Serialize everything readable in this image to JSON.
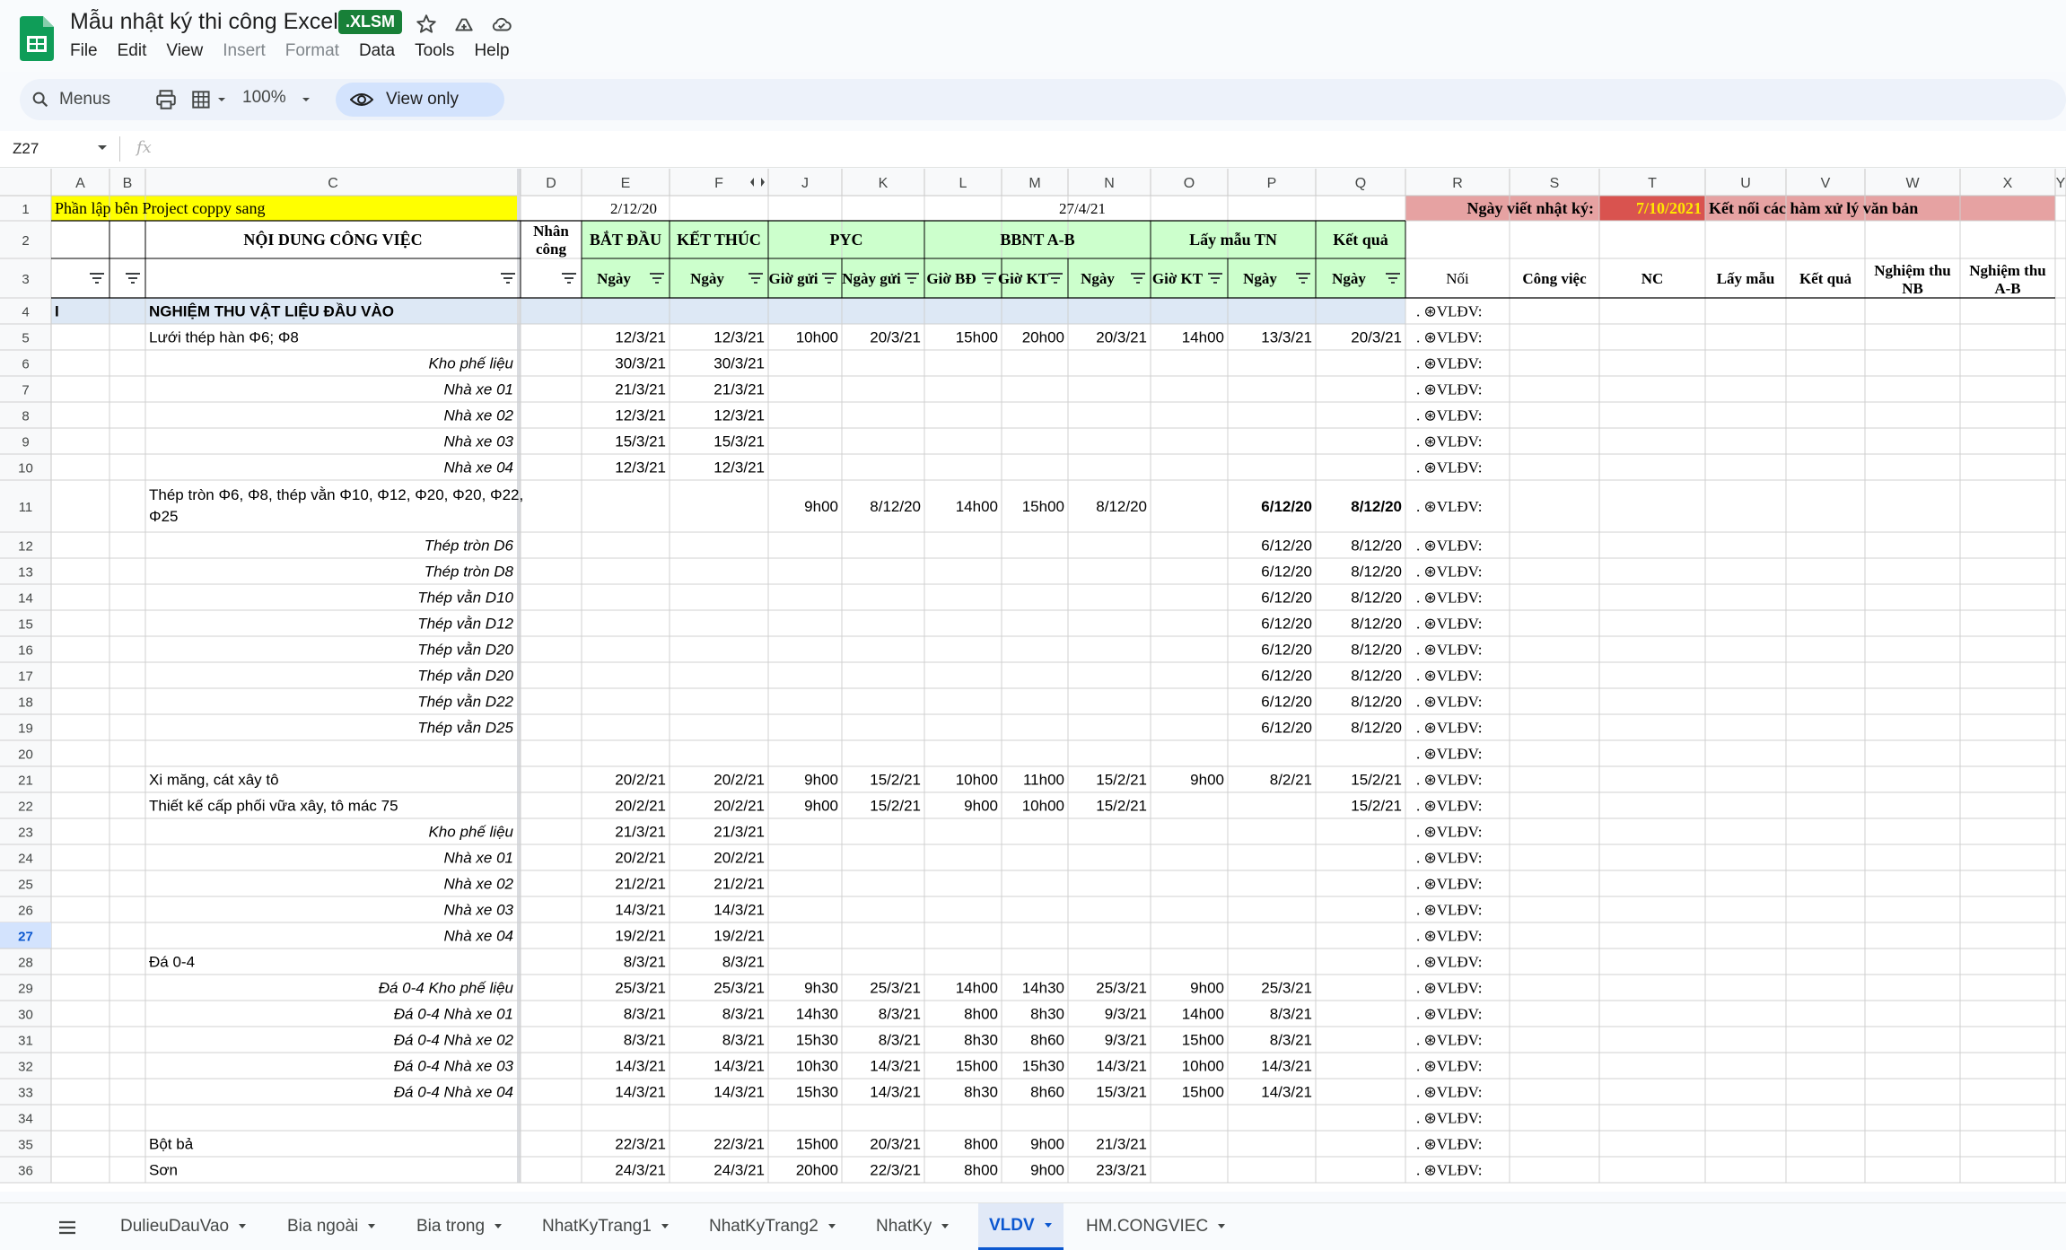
{
  "header": {
    "title": "Mẫu nhật ký thi công Excel",
    "file_ext": ".XLSM",
    "menu": [
      {
        "label": "File",
        "enabled": true
      },
      {
        "label": "Edit",
        "enabled": true
      },
      {
        "label": "View",
        "enabled": true
      },
      {
        "label": "Insert",
        "enabled": false
      },
      {
        "label": "Format",
        "enabled": false
      },
      {
        "label": "Data",
        "enabled": true
      },
      {
        "label": "Tools",
        "enabled": true
      },
      {
        "label": "Help",
        "enabled": true
      }
    ]
  },
  "toolbar": {
    "menus_label": "Menus",
    "zoom": "100%",
    "view_only_label": "View only"
  },
  "formula_bar": {
    "name_box": "Z27",
    "fx": "fx"
  },
  "colors": {
    "accent": "#0b57d0",
    "brand_green": "#188038",
    "header_yellow": "#ffff00",
    "header_green": "#ccffcc",
    "header_pink": "#e6a2a2",
    "date_yellow": "#ffe600"
  },
  "grid": {
    "columns": [
      "A",
      "B",
      "C",
      "D",
      "E",
      "F",
      "J",
      "K",
      "L",
      "M",
      "N",
      "O",
      "P",
      "Q",
      "R",
      "S",
      "T",
      "U",
      "V",
      "W",
      "X",
      "Y"
    ],
    "row1": {
      "a": "Phần lập bên Project coppy sang",
      "e": "2/12/20",
      "n": "27/4/21",
      "r": "Ngày viết nhật ký:",
      "t": "7/10/2021",
      "u": "Kết nối các hàm xử lý văn bản"
    },
    "row2": {
      "c": "NỘI DUNG CÔNG VIỆC",
      "d": "Nhân công",
      "e": "BẮT ĐẦU",
      "f": "KẾT THÚC",
      "pyc": "PYC",
      "bbnt": "BBNT A-B",
      "lay_mau": "Lấy mẫu TN",
      "ket_qua": "Kết quả"
    },
    "row3": {
      "e": "Ngày",
      "f": "Ngày",
      "j": "Giờ gửi",
      "k": "Ngày gửi",
      "l": "Giờ BĐ",
      "m": "Giờ KT",
      "n": "Ngày",
      "o": "Giờ KT",
      "p": "Ngày",
      "q": "Ngày",
      "r": "Nối",
      "s": "Công việc",
      "t": "NC",
      "u": "Lấy mẫu",
      "v": "Kết quả",
      "w": "Nghiệm thu NB",
      "x": "Nghiệm thu A-B"
    },
    "rows": [
      {
        "n": "4",
        "a": "I",
        "c": "NGHIỆM THU VẬT LIỆU ĐẦU VÀO",
        "r": ". ⊛VLĐV:",
        "section": true
      },
      {
        "n": "5",
        "c": "Lưới thép hàn Φ6; Φ8",
        "e": "12/3/21",
        "f": "12/3/21",
        "j": "10h00",
        "k": "20/3/21",
        "l": "15h00",
        "m": "20h00",
        "nn": "20/3/21",
        "o": "14h00",
        "p": "13/3/21",
        "q": "20/3/21",
        "r": ". ⊛VLĐV:"
      },
      {
        "n": "6",
        "c": "Kho phế liệu",
        "ci": true,
        "e": "30/3/21",
        "f": "30/3/21",
        "r": ". ⊛VLĐV:"
      },
      {
        "n": "7",
        "c": "Nhà xe 01",
        "ci": true,
        "e": "21/3/21",
        "f": "21/3/21",
        "r": ". ⊛VLĐV:"
      },
      {
        "n": "8",
        "c": "Nhà xe 02",
        "ci": true,
        "e": "12/3/21",
        "f": "12/3/21",
        "r": ". ⊛VLĐV:"
      },
      {
        "n": "9",
        "c": "Nhà xe 03",
        "ci": true,
        "e": "15/3/21",
        "f": "15/3/21",
        "r": ". ⊛VLĐV:"
      },
      {
        "n": "10",
        "c": "Nhà xe 04",
        "ci": true,
        "e": "12/3/21",
        "f": "12/3/21",
        "r": ". ⊛VLĐV:"
      },
      {
        "n": "11",
        "c": "Thép tròn Φ6, Φ8, thép vằn Φ10, Φ12, Φ20, Φ20, Φ22,",
        "c2": "Φ25",
        "j": "9h00",
        "k": "8/12/20",
        "l": "14h00",
        "m": "15h00",
        "nn": "8/12/20",
        "p": "6/12/20",
        "q": "8/12/20",
        "bold_pq": true,
        "r": ". ⊛VLĐV:",
        "tall": true
      },
      {
        "n": "12",
        "c": "Thép tròn D6",
        "ci": true,
        "p": "6/12/20",
        "q": "8/12/20",
        "r": ". ⊛VLĐV:"
      },
      {
        "n": "13",
        "c": "Thép tròn D8",
        "ci": true,
        "p": "6/12/20",
        "q": "8/12/20",
        "r": ". ⊛VLĐV:"
      },
      {
        "n": "14",
        "c": "Thép vằn D10",
        "ci": true,
        "p": "6/12/20",
        "q": "8/12/20",
        "r": ". ⊛VLĐV:"
      },
      {
        "n": "15",
        "c": "Thép vằn D12",
        "ci": true,
        "p": "6/12/20",
        "q": "8/12/20",
        "r": ". ⊛VLĐV:"
      },
      {
        "n": "16",
        "c": "Thép vằn D20",
        "ci": true,
        "p": "6/12/20",
        "q": "8/12/20",
        "r": ". ⊛VLĐV:"
      },
      {
        "n": "17",
        "c": "Thép vằn D20",
        "ci": true,
        "p": "6/12/20",
        "q": "8/12/20",
        "r": ". ⊛VLĐV:"
      },
      {
        "n": "18",
        "c": "Thép vằn D22",
        "ci": true,
        "p": "6/12/20",
        "q": "8/12/20",
        "r": ". ⊛VLĐV:"
      },
      {
        "n": "19",
        "c": "Thép vằn D25",
        "ci": true,
        "p": "6/12/20",
        "q": "8/12/20",
        "r": ". ⊛VLĐV:"
      },
      {
        "n": "20",
        "r": ". ⊛VLĐV:"
      },
      {
        "n": "21",
        "c": "Xi măng, cát xây tô",
        "e": "20/2/21",
        "f": "20/2/21",
        "j": "9h00",
        "k": "15/2/21",
        "l": "10h00",
        "m": "11h00",
        "nn": "15/2/21",
        "o": "9h00",
        "p": "8/2/21",
        "q": "15/2/21",
        "r": ". ⊛VLĐV:"
      },
      {
        "n": "22",
        "c": "Thiết kế cấp phối vữa xây, tô mác 75",
        "e": "20/2/21",
        "f": "20/2/21",
        "j": "9h00",
        "k": "15/2/21",
        "l": "9h00",
        "m": "10h00",
        "nn": "15/2/21",
        "q": "15/2/21",
        "r": ". ⊛VLĐV:"
      },
      {
        "n": "23",
        "c": "Kho phế liệu",
        "ci": true,
        "e": "21/3/21",
        "f": "21/3/21",
        "r": ". ⊛VLĐV:"
      },
      {
        "n": "24",
        "c": "Nhà xe 01",
        "ci": true,
        "e": "20/2/21",
        "f": "20/2/21",
        "r": ". ⊛VLĐV:"
      },
      {
        "n": "25",
        "c": "Nhà xe 02",
        "ci": true,
        "e": "21/2/21",
        "f": "21/2/21",
        "r": ". ⊛VLĐV:"
      },
      {
        "n": "26",
        "c": "Nhà xe 03",
        "ci": true,
        "e": "14/3/21",
        "f": "14/3/21",
        "r": ". ⊛VLĐV:"
      },
      {
        "n": "27",
        "c": "Nhà xe 04",
        "ci": true,
        "e": "19/2/21",
        "f": "19/2/21",
        "r": ". ⊛VLĐV:",
        "selected": true
      },
      {
        "n": "28",
        "c": "Đá 0-4",
        "e": "8/3/21",
        "f": "8/3/21",
        "r": ". ⊛VLĐV:"
      },
      {
        "n": "29",
        "c": "Đá 0-4 Kho phế liệu",
        "ci": true,
        "e": "25/3/21",
        "f": "25/3/21",
        "j": "9h30",
        "k": "25/3/21",
        "l": "14h00",
        "m": "14h30",
        "nn": "25/3/21",
        "o": "9h00",
        "p": "25/3/21",
        "r": ". ⊛VLĐV:"
      },
      {
        "n": "30",
        "c": "Đá 0-4 Nhà xe 01",
        "ci": true,
        "e": "8/3/21",
        "f": "8/3/21",
        "j": "14h30",
        "k": "8/3/21",
        "l": "8h00",
        "m": "8h30",
        "nn": "9/3/21",
        "o": "14h00",
        "p": "8/3/21",
        "r": ". ⊛VLĐV:"
      },
      {
        "n": "31",
        "c": "Đá 0-4 Nhà xe 02",
        "ci": true,
        "e": "8/3/21",
        "f": "8/3/21",
        "j": "15h30",
        "k": "8/3/21",
        "l": "8h30",
        "m": "8h60",
        "nn": "9/3/21",
        "o": "15h00",
        "p": "8/3/21",
        "r": ". ⊛VLĐV:"
      },
      {
        "n": "32",
        "c": "Đá 0-4 Nhà xe 03",
        "ci": true,
        "e": "14/3/21",
        "f": "14/3/21",
        "j": "10h30",
        "k": "14/3/21",
        "l": "15h00",
        "m": "15h30",
        "nn": "14/3/21",
        "o": "10h00",
        "p": "14/3/21",
        "r": ". ⊛VLĐV:"
      },
      {
        "n": "33",
        "c": "Đá 0-4 Nhà xe 04",
        "ci": true,
        "e": "14/3/21",
        "f": "14/3/21",
        "j": "15h30",
        "k": "14/3/21",
        "l": "8h30",
        "m": "8h60",
        "nn": "15/3/21",
        "o": "15h00",
        "p": "14/3/21",
        "r": ". ⊛VLĐV:"
      },
      {
        "n": "34",
        "r": ". ⊛VLĐV:"
      },
      {
        "n": "35",
        "c": "Bột bả",
        "e": "22/3/21",
        "f": "22/3/21",
        "j": "15h00",
        "k": "20/3/21",
        "l": "8h00",
        "m": "9h00",
        "nn": "21/3/21",
        "r": ". ⊛VLĐV:"
      },
      {
        "n": "36",
        "c": "Sơn",
        "e": "24/3/21",
        "f": "24/3/21",
        "j": "20h00",
        "k": "22/3/21",
        "l": "8h00",
        "m": "9h00",
        "nn": "23/3/21",
        "r": ". ⊛VLĐV:"
      }
    ]
  },
  "sheet_tabs": [
    {
      "label": "DulieuDauVao",
      "active": false
    },
    {
      "label": "Bia ngoài",
      "active": false
    },
    {
      "label": "Bia trong",
      "active": false
    },
    {
      "label": "NhatKyTrang1",
      "active": false
    },
    {
      "label": "NhatKyTrang2",
      "active": false
    },
    {
      "label": "NhatKy",
      "active": false
    },
    {
      "label": "VLDV",
      "active": true
    },
    {
      "label": "HM.CONGVIEC",
      "active": false
    }
  ]
}
